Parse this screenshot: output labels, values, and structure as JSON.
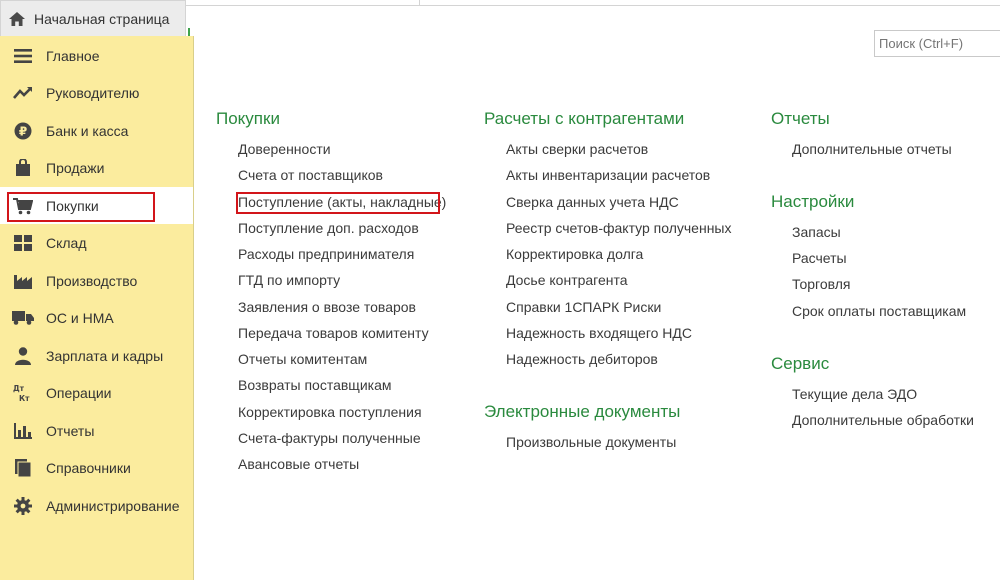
{
  "tab": {
    "home_label": "Начальная страница"
  },
  "search": {
    "placeholder": "Поиск (Ctrl+F)"
  },
  "sidebar": {
    "items": [
      {
        "label": "Главное",
        "icon": "list-icon"
      },
      {
        "label": "Руководителю",
        "icon": "trend-icon"
      },
      {
        "label": "Банк и касса",
        "icon": "ruble-coin-icon"
      },
      {
        "label": "Продажи",
        "icon": "shopping-bag-icon"
      },
      {
        "label": "Покупки",
        "icon": "cart-icon",
        "active": true
      },
      {
        "label": "Склад",
        "icon": "warehouse-icon"
      },
      {
        "label": "Производство",
        "icon": "factory-icon"
      },
      {
        "label": "ОС и НМА",
        "icon": "truck-icon"
      },
      {
        "label": "Зарплата и кадры",
        "icon": "person-icon"
      },
      {
        "label": "Операции",
        "icon": "debit-credit-icon"
      },
      {
        "label": "Отчеты",
        "icon": "bar-chart-icon"
      },
      {
        "label": "Справочники",
        "icon": "book-icon"
      },
      {
        "label": "Администрирование",
        "icon": "gear-icon"
      }
    ]
  },
  "columns": [
    {
      "groups": [
        {
          "title": "Покупки",
          "links": [
            "Доверенности",
            "Счета от поставщиков",
            "Поступление (акты, накладные)",
            "Поступление доп. расходов",
            "Расходы предпринимателя",
            "ГТД по импорту",
            "Заявления о ввозе товаров",
            "Передача товаров комитенту",
            "Отчеты комитентам",
            "Возвраты поставщикам",
            "Корректировка поступления",
            "Счета-фактуры полученные",
            "Авансовые отчеты"
          ]
        }
      ]
    },
    {
      "groups": [
        {
          "title": "Расчеты с контрагентами",
          "links": [
            "Акты сверки расчетов",
            "Акты инвентаризации расчетов",
            "Сверка данных учета НДС",
            "Реестр счетов-фактур полученных",
            "Корректировка долга",
            "Досье контрагента",
            "Справки 1СПАРК Риски",
            "Надежность входящего НДС",
            "Надежность дебиторов"
          ]
        },
        {
          "title": "Электронные документы",
          "links": [
            "Произвольные документы"
          ]
        }
      ]
    },
    {
      "groups": [
        {
          "title": "Отчеты",
          "links": [
            "Дополнительные отчеты"
          ]
        },
        {
          "title": "Настройки",
          "links": [
            "Запасы",
            "Расчеты",
            "Торговля",
            "Срок оплаты поставщикам"
          ]
        },
        {
          "title": "Сервис",
          "links": [
            "Текущие дела ЭДО",
            "Дополнительные обработки"
          ]
        }
      ]
    }
  ],
  "colors": {
    "sidebar_bg": "#fbec9e",
    "group_title": "#2a8a3e",
    "highlight": "#d2151a"
  }
}
